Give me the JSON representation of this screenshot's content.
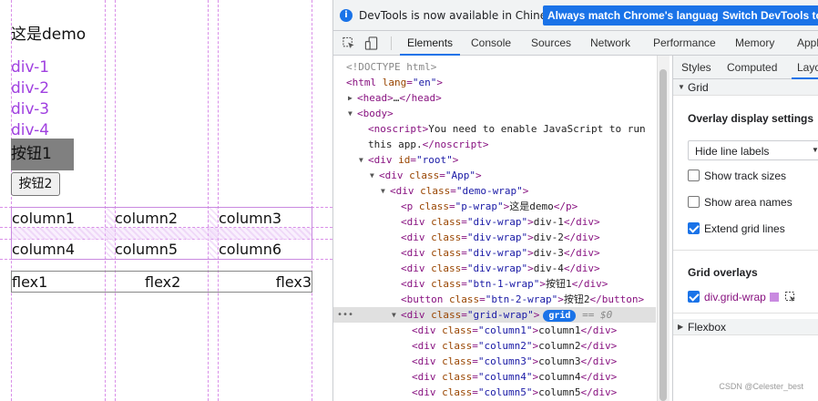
{
  "page": {
    "title": "这是demo",
    "divs": [
      "div-1",
      "div-2",
      "div-3",
      "div-4"
    ],
    "btn1": "按钮1",
    "btn2": "按钮2",
    "grid_cells": [
      "column1",
      "column2",
      "column3",
      "column4",
      "column5",
      "column6"
    ],
    "flex_items": [
      "flex1",
      "flex2",
      "flex3"
    ],
    "colors": {
      "link_purple": "#a040e0",
      "grid_overlay": "#c98ae0",
      "button_gray": "#808080"
    }
  },
  "devtools": {
    "infobar": {
      "message": "DevTools is now available in Chinese!",
      "btn_match": "Always match Chrome's language",
      "btn_switch": "Switch DevTools to"
    },
    "tabs": [
      "Elements",
      "Console",
      "Sources",
      "Network",
      "Performance",
      "Memory",
      "Appl"
    ],
    "active_tab": "Elements",
    "dom_lines": [
      {
        "indent": 0,
        "tri": "",
        "html": "<span class=\"cmt\">&lt;!DOCTYPE html&gt;</span>"
      },
      {
        "indent": 0,
        "tri": "",
        "html": "<span class=\"tag\">&lt;html</span> <span class=\"attr\">lang</span><span class=\"tag\">=</span><span class=\"val\">\"en\"</span><span class=\"tag\">&gt;</span>"
      },
      {
        "indent": 1,
        "tri": "▶",
        "html": "<span class=\"tag\">&lt;head&gt;</span><span class=\"txt\">…</span><span class=\"tag\">&lt;/head&gt;</span>"
      },
      {
        "indent": 1,
        "tri": "▼",
        "html": "<span class=\"tag\">&lt;body&gt;</span>"
      },
      {
        "indent": 2,
        "tri": "",
        "html": "<span class=\"tag\">&lt;noscript&gt;</span><span class=\"txt\">You need to enable JavaScript to run</span>"
      },
      {
        "indent": 2,
        "tri": "",
        "html": "<span class=\"txt\">this app.</span><span class=\"tag\">&lt;/noscript&gt;</span>"
      },
      {
        "indent": 2,
        "tri": "▼",
        "html": "<span class=\"tag\">&lt;div</span> <span class=\"attr\">id</span><span class=\"tag\">=</span><span class=\"val\">\"root\"</span><span class=\"tag\">&gt;</span>"
      },
      {
        "indent": 3,
        "tri": "▼",
        "html": "<span class=\"tag\">&lt;div</span> <span class=\"attr\">class</span><span class=\"tag\">=</span><span class=\"val\">\"App\"</span><span class=\"tag\">&gt;</span>"
      },
      {
        "indent": 4,
        "tri": "▼",
        "html": "<span class=\"tag\">&lt;div</span> <span class=\"attr\">class</span><span class=\"tag\">=</span><span class=\"val\">\"demo-wrap\"</span><span class=\"tag\">&gt;</span>"
      },
      {
        "indent": 5,
        "tri": "",
        "html": "<span class=\"tag\">&lt;p</span> <span class=\"attr\">class</span><span class=\"tag\">=</span><span class=\"val\">\"p-wrap\"</span><span class=\"tag\">&gt;</span><span class=\"txt\">这是demo</span><span class=\"tag\">&lt;/p&gt;</span>"
      },
      {
        "indent": 5,
        "tri": "",
        "html": "<span class=\"tag\">&lt;div</span> <span class=\"attr\">class</span><span class=\"tag\">=</span><span class=\"val\">\"div-wrap\"</span><span class=\"tag\">&gt;</span><span class=\"txt\">div-1</span><span class=\"tag\">&lt;/div&gt;</span>"
      },
      {
        "indent": 5,
        "tri": "",
        "html": "<span class=\"tag\">&lt;div</span> <span class=\"attr\">class</span><span class=\"tag\">=</span><span class=\"val\">\"div-wrap\"</span><span class=\"tag\">&gt;</span><span class=\"txt\">div-2</span><span class=\"tag\">&lt;/div&gt;</span>"
      },
      {
        "indent": 5,
        "tri": "",
        "html": "<span class=\"tag\">&lt;div</span> <span class=\"attr\">class</span><span class=\"tag\">=</span><span class=\"val\">\"div-wrap\"</span><span class=\"tag\">&gt;</span><span class=\"txt\">div-3</span><span class=\"tag\">&lt;/div&gt;</span>"
      },
      {
        "indent": 5,
        "tri": "",
        "html": "<span class=\"tag\">&lt;div</span> <span class=\"attr\">class</span><span class=\"tag\">=</span><span class=\"val\">\"div-wrap\"</span><span class=\"tag\">&gt;</span><span class=\"txt\">div-4</span><span class=\"tag\">&lt;/div&gt;</span>"
      },
      {
        "indent": 5,
        "tri": "",
        "html": "<span class=\"tag\">&lt;div</span> <span class=\"attr\">class</span><span class=\"tag\">=</span><span class=\"val\">\"btn-1-wrap\"</span><span class=\"tag\">&gt;</span><span class=\"txt\">按钮1</span><span class=\"tag\">&lt;/div&gt;</span>"
      },
      {
        "indent": 5,
        "tri": "",
        "html": "<span class=\"tag\">&lt;button</span> <span class=\"attr\">class</span><span class=\"tag\">=</span><span class=\"val\">\"btn-2-wrap\"</span><span class=\"tag\">&gt;</span><span class=\"txt\">按钮2</span><span class=\"tag\">&lt;/button&gt;</span>"
      },
      {
        "indent": 5,
        "tri": "▼",
        "selected": true,
        "html": "<span class=\"tag\">&lt;div</span> <span class=\"attr\">class</span><span class=\"tag\">=</span><span class=\"val\">\"grid-wrap\"</span><span class=\"tag\">&gt;</span><span class=\"grid-badge\">grid</span> <span class=\"cmt\">== <i>$0</i></span>"
      },
      {
        "indent": 6,
        "tri": "",
        "html": "<span class=\"tag\">&lt;div</span> <span class=\"attr\">class</span><span class=\"tag\">=</span><span class=\"val\">\"column1\"</span><span class=\"tag\">&gt;</span><span class=\"txt\">column1</span><span class=\"tag\">&lt;/div&gt;</span>"
      },
      {
        "indent": 6,
        "tri": "",
        "html": "<span class=\"tag\">&lt;div</span> <span class=\"attr\">class</span><span class=\"tag\">=</span><span class=\"val\">\"column2\"</span><span class=\"tag\">&gt;</span><span class=\"txt\">column2</span><span class=\"tag\">&lt;/div&gt;</span>"
      },
      {
        "indent": 6,
        "tri": "",
        "html": "<span class=\"tag\">&lt;div</span> <span class=\"attr\">class</span><span class=\"tag\">=</span><span class=\"val\">\"column3\"</span><span class=\"tag\">&gt;</span><span class=\"txt\">column3</span><span class=\"tag\">&lt;/div&gt;</span>"
      },
      {
        "indent": 6,
        "tri": "",
        "html": "<span class=\"tag\">&lt;div</span> <span class=\"attr\">class</span><span class=\"tag\">=</span><span class=\"val\">\"column4\"</span><span class=\"tag\">&gt;</span><span class=\"txt\">column4</span><span class=\"tag\">&lt;/div&gt;</span>"
      },
      {
        "indent": 6,
        "tri": "",
        "html": "<span class=\"tag\">&lt;div</span> <span class=\"attr\">class</span><span class=\"tag\">=</span><span class=\"val\">\"column5\"</span><span class=\"tag\">&gt;</span><span class=\"txt\">column5</span><span class=\"tag\">&lt;/div&gt;</span>"
      }
    ],
    "sidebar": {
      "tabs": [
        "Styles",
        "Computed",
        "Layo"
      ],
      "grid_section": "Grid",
      "overlay_title": "Overlay display settings",
      "select_value": "Hide line labels",
      "checks": [
        {
          "label": "Show track sizes",
          "checked": false
        },
        {
          "label": "Show area names",
          "checked": false
        },
        {
          "label": "Extend grid lines",
          "checked": true
        }
      ],
      "overlays_title": "Grid overlays",
      "overlay_item": "div.grid-wrap",
      "flexbox_section": "Flexbox"
    },
    "watermark": "CSDN @Celester_best"
  }
}
